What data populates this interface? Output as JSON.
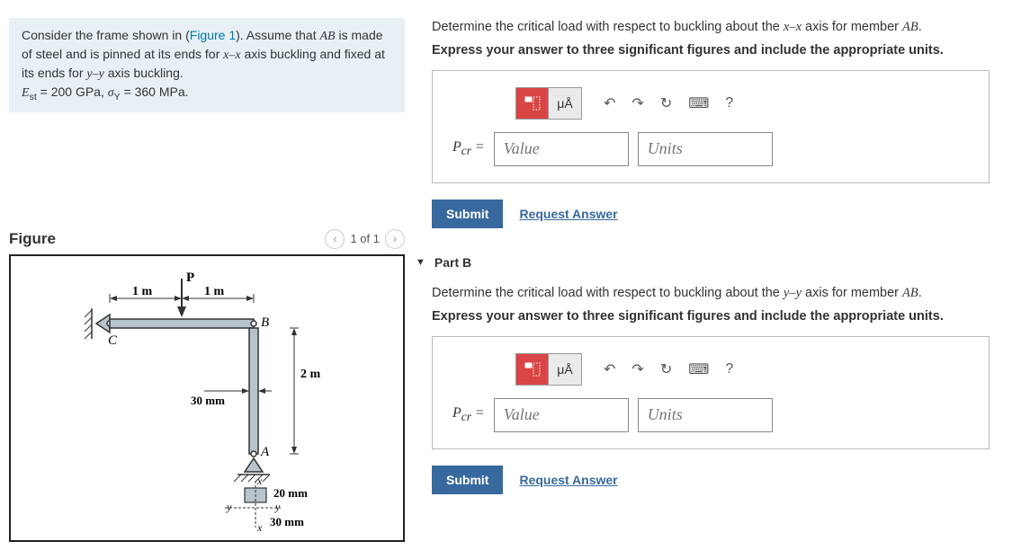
{
  "problem": {
    "line1_a": "Consider the frame shown in (",
    "figure_link": "Figure 1",
    "line1_b": "). Assume that ",
    "AB": "AB",
    "line2": " is made of steel and is pinned at its ends for ",
    "xx": "x–x",
    "line2b": " axis buckling and fixed at its ends for ",
    "yy": "y–y",
    "line2c": " axis buckling.",
    "params": "E_st = 200 GPa, σ_Y = 360 MPa."
  },
  "figure": {
    "title": "Figure",
    "pager": "1 of 1",
    "labels": {
      "P": "P",
      "m1a": "1 m",
      "m1b": "1 m",
      "C": "C",
      "B": "B",
      "A": "A",
      "h": "2 m",
      "w30": "30 mm",
      "d20": "20 mm",
      "d30": "30 mm",
      "x": "x",
      "y": "y"
    }
  },
  "partA": {
    "question_a": "Determine the critical load with respect to buckling about the ",
    "axis": "x–x",
    "question_b": " axis for member ",
    "AB": "AB",
    "dot": ".",
    "instruction": "Express your answer to three significant figures and include the appropriate units.",
    "label": "P_cr =",
    "value_ph": "Value",
    "units_ph": "Units",
    "submit": "Submit",
    "request": "Request Answer",
    "mu": "μÅ",
    "help": "?"
  },
  "partB": {
    "header": "Part B",
    "question_a": "Determine the critical load with respect to buckling about the ",
    "axis": "y–y",
    "question_b": " axis for member ",
    "AB": "AB",
    "dot": ".",
    "instruction": "Express your answer to three significant figures and include the appropriate units.",
    "label": "P_cr =",
    "value_ph": "Value",
    "units_ph": "Units",
    "submit": "Submit",
    "request": "Request Answer",
    "mu": "μÅ",
    "help": "?"
  }
}
